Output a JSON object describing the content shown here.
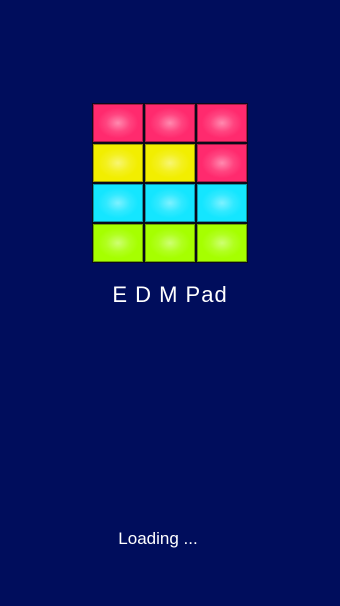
{
  "app": {
    "title": "E D M Pad",
    "loading_text": "Loading ..."
  },
  "logo": {
    "icon": "pad-grid-logo-icon",
    "rows": [
      [
        "#ff2a6e",
        "#ff2a6e",
        "#ff2a6e"
      ],
      [
        "#f2ee00",
        "#f2ee00",
        "#ff2a6e"
      ],
      [
        "#14e6ff",
        "#14e6ff",
        "#14e6ff"
      ],
      [
        "#a6ff00",
        "#a6ff00",
        "#a6ff00"
      ]
    ]
  },
  "colors": {
    "background": "#000d5c",
    "text": "#ffffff"
  }
}
